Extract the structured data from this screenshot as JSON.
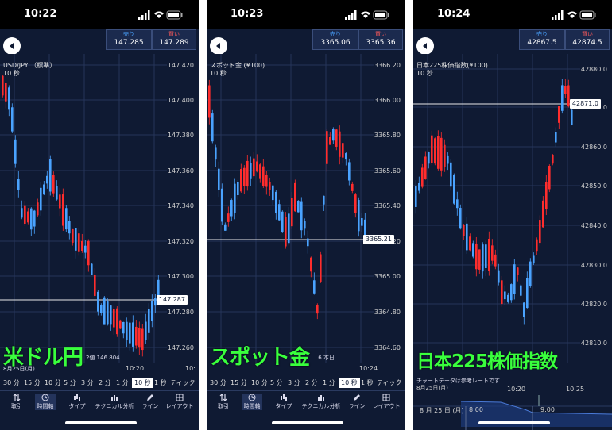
{
  "screens": [
    {
      "time": "10:22",
      "sell_label": "売り",
      "sell_price": "147.285",
      "buy_label": "買い",
      "buy_price": "147.289",
      "symbol": "USD/JPY （標準）",
      "interval": "10 秒",
      "y_ticks": [
        "147.420",
        "147.400",
        "147.380",
        "147.360",
        "147.340",
        "147.320",
        "147.300",
        "147.280",
        "147.260"
      ],
      "current_price": "147.287",
      "x_ticks": [
        "10:20",
        "10:"
      ],
      "ohlc_text": "2値 146.804",
      "overlay_title": "米ドル円",
      "date_text": "8月25日(月)"
    },
    {
      "time": "10:23",
      "sell_label": "売り",
      "sell_price": "3365.06",
      "buy_label": "買い",
      "buy_price": "3365.36",
      "symbol": "スポット金 (¥100)",
      "interval": "10 秒",
      "y_ticks": [
        "3366.20",
        "3366.00",
        "3365.80",
        "3365.60",
        "3365.40",
        "3365.20",
        "3365.00",
        "3364.80",
        "3364.60"
      ],
      "current_price": "3365.21",
      "x_ticks": [
        "10:24"
      ],
      "ohlc_text": ".6 本日",
      "overlay_title": "スポット金",
      "date_text": ""
    },
    {
      "time": "10:24",
      "sell_label": "売り",
      "sell_price": "42867.5",
      "buy_label": "買い",
      "buy_price": "42874.5",
      "symbol": "日本225株価指数(¥100)",
      "interval": "10 秒",
      "y_ticks": [
        "42880.0",
        "42870.0",
        "42860.0",
        "42850.0",
        "42840.0",
        "42830.0",
        "42820.0",
        "42810.0"
      ],
      "current_price": "42871.0",
      "x_ticks": [
        "10:20",
        "10:25"
      ],
      "ohlc_text": "チャートデータは参考レートです",
      "overlay_title": "日本225株価指数",
      "date_text": "8月25日(月)",
      "nav_date": "8 月 25 日 (月)",
      "nav_t1": "8:00",
      "nav_t2": "9:00",
      "nav_mark": "5"
    }
  ],
  "timeframes": [
    "30 分",
    "15 分",
    "10 分",
    "5 分",
    "3 分",
    "2 分",
    "1 分",
    "10 秒",
    "1 秒",
    "ティック"
  ],
  "toolbar": [
    "取引",
    "時間軸",
    "タイプ",
    "テクニカル分析",
    "ライン",
    "レイアウト"
  ],
  "colors": {
    "up": "#ff2d2d",
    "down": "#4aa3ff",
    "bg": "#0f1a33",
    "overlay": "#39ff3d"
  }
}
